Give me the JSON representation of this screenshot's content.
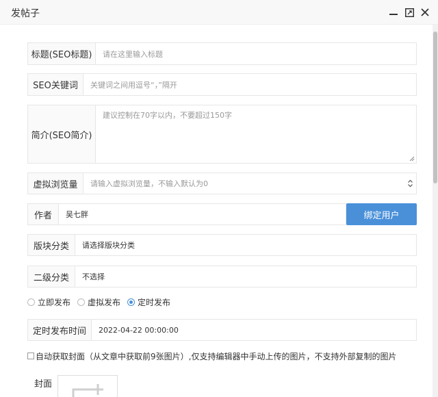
{
  "window": {
    "title": "发帖子"
  },
  "form": {
    "title": {
      "label": "标题(SEO标题)",
      "placeholder": "请在这里输入标题"
    },
    "keywords": {
      "label": "SEO关键词",
      "placeholder": "关键词之间用逗号“，”隔开"
    },
    "summary": {
      "label": "简介(SEO简介)",
      "placeholder": "建议控制在70字以内，不要超过150字"
    },
    "views": {
      "label": "虚拟浏览量",
      "placeholder": "请输入虚拟浏览量，不输入默认为0"
    },
    "author": {
      "label": "作者",
      "value": "吴七胖",
      "bind_button": "绑定用户"
    },
    "section": {
      "label": "版块分类",
      "value": "请选择版块分类"
    },
    "subcategory": {
      "label": "二级分类",
      "value": "不选择"
    },
    "publish_modes": [
      {
        "label": "立即发布",
        "checked": false
      },
      {
        "label": "虚拟发布",
        "checked": false
      },
      {
        "label": "定时发布",
        "checked": true
      }
    ],
    "schedule": {
      "label": "定时发布时间",
      "value": "2022-04-22 00:00:00"
    },
    "auto_cover": {
      "label": "自动获取封面（从文章中获取前9张图片）,仅支持编辑器中手动上传的图片，不支持外部复制的图片",
      "checked": false
    },
    "cover": {
      "label": "封面"
    }
  },
  "colors": {
    "primary": "#4a90d9",
    "border": "#e6e6e6",
    "label_bg": "#fafafa"
  },
  "icons": [
    "minimize-icon",
    "maximize-icon",
    "close-icon",
    "add-image-icon"
  ]
}
